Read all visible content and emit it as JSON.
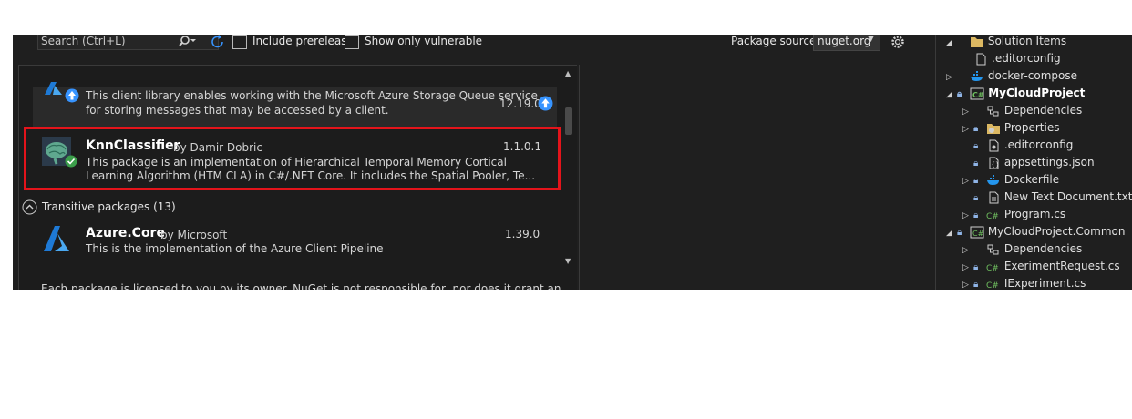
{
  "toolbar": {
    "search_placeholder": "Search (Ctrl+L)",
    "include_prerelease": "Include prerelease",
    "show_only_vulnerable": "Show only vulnerable",
    "package_source_label": "Package source:",
    "package_source_value": "nuget.org"
  },
  "packages": {
    "queue": {
      "description_line1": "This client library enables working with the Microsoft Azure Storage Queue service",
      "description_line2": "for storing messages that may be accessed by a client.",
      "version": "12.19.0"
    },
    "knn": {
      "name": "KnnClassifier",
      "author": "by Damir Dobric",
      "version": "1.1.0.1",
      "description_line1": "This package is an implementation of Hierarchical Temporal Memory Cortical",
      "description_line2": "Learning Algorithm (HTM CLA) in C#/.NET Core. It includes the Spatial Pooler, Te..."
    },
    "transitive_header": "Transitive packages (13)",
    "azure_core": {
      "name": "Azure.Core",
      "author": "by Microsoft",
      "version": "1.39.0",
      "description": "This is the implementation of the Azure Client Pipeline"
    }
  },
  "license_notice": "Each package is licensed to you by its owner. NuGet is not responsible for, nor does it grant any licenses to,",
  "solution_tree": [
    {
      "label": "Solution Items"
    },
    {
      "label": ".editorconfig"
    },
    {
      "label": "docker-compose"
    },
    {
      "label": "MyCloudProject"
    },
    {
      "label": "Dependencies"
    },
    {
      "label": "Properties"
    },
    {
      "label": ".editorconfig"
    },
    {
      "label": "appsettings.json"
    },
    {
      "label": "Dockerfile"
    },
    {
      "label": "New Text Document.txt"
    },
    {
      "label": "Program.cs"
    },
    {
      "label": "MyCloudProject.Common"
    },
    {
      "label": "Dependencies"
    },
    {
      "label": "ExerimentRequest.cs"
    },
    {
      "label": "IExperiment.cs"
    }
  ],
  "colors": {
    "highlight": "#e4141b",
    "accent": "#3794ff",
    "background": "#1f1f1f"
  }
}
